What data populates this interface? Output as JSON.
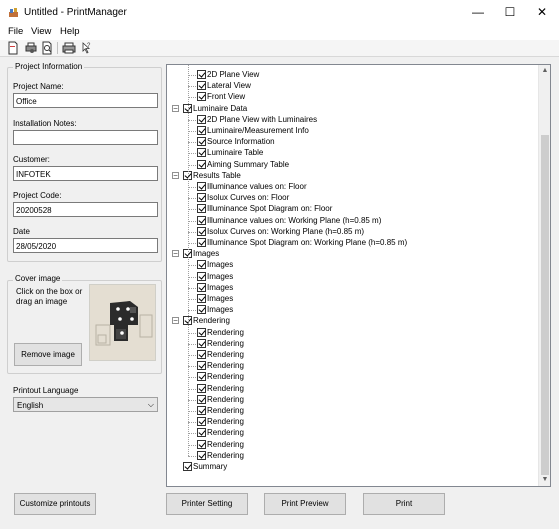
{
  "window": {
    "title": "Untitled - PrintManager",
    "minimize_glyph": "—",
    "maximize_glyph": "☐",
    "close_glyph": "✕"
  },
  "menu": [
    "File",
    "View",
    "Help"
  ],
  "toolbar": {
    "icons": [
      "new-document-icon",
      "print-setup-icon",
      "print-preview-icon",
      "print-icon",
      "help-pointer-icon"
    ]
  },
  "project_info": {
    "group_title": "Project Information",
    "project_name_label": "Project Name:",
    "project_name_value": "Office",
    "installation_notes_label": "Installation Notes:",
    "installation_notes_value": "",
    "customer_label": "Customer:",
    "customer_value": "INFOTEK",
    "project_code_label": "Project Code:",
    "project_code_value": "20200528",
    "date_label": "Date",
    "date_value": "28/05/2020"
  },
  "cover_image": {
    "group_title": "Cover image",
    "hint": "Click on the box or drag an image",
    "remove_label": "Remove image"
  },
  "printout_language": {
    "label": "Printout Language",
    "selected": "English"
  },
  "tree": {
    "rows": [
      {
        "label": "2D Plane View",
        "indent": 1,
        "checked": true
      },
      {
        "label": "Lateral View",
        "indent": 1,
        "checked": true
      },
      {
        "label": "Front View",
        "indent": 1,
        "checked": true
      },
      {
        "label": "Luminaire Data",
        "indent": 0,
        "checked": true,
        "expander": "−"
      },
      {
        "label": "2D Plane View with Luminaires",
        "indent": 1,
        "checked": true
      },
      {
        "label": "Luminaire/Measurement Info",
        "indent": 1,
        "checked": true
      },
      {
        "label": "Source Information",
        "indent": 1,
        "checked": true
      },
      {
        "label": "Luminaire Table",
        "indent": 1,
        "checked": true
      },
      {
        "label": "Aiming Summary Table",
        "indent": 1,
        "checked": true
      },
      {
        "label": "Results Table",
        "indent": 0,
        "checked": true,
        "expander": "−"
      },
      {
        "label": "Illuminance values on: Floor",
        "indent": 1,
        "checked": true
      },
      {
        "label": "Isolux Curves on: Floor",
        "indent": 1,
        "checked": true
      },
      {
        "label": "Illuminance Spot Diagram on: Floor",
        "indent": 1,
        "checked": true
      },
      {
        "label": "Illuminance values on: Working Plane (h=0.85 m)",
        "indent": 1,
        "checked": true
      },
      {
        "label": "Isolux Curves on: Working Plane (h=0.85 m)",
        "indent": 1,
        "checked": true
      },
      {
        "label": "Illuminance Spot Diagram on: Working Plane (h=0.85 m)",
        "indent": 1,
        "checked": true
      },
      {
        "label": "Images",
        "indent": 0,
        "checked": true,
        "expander": "−"
      },
      {
        "label": "Images",
        "indent": 1,
        "checked": true
      },
      {
        "label": "Images",
        "indent": 1,
        "checked": true
      },
      {
        "label": "Images",
        "indent": 1,
        "checked": true
      },
      {
        "label": "Images",
        "indent": 1,
        "checked": true
      },
      {
        "label": "Images",
        "indent": 1,
        "checked": true
      },
      {
        "label": "Rendering",
        "indent": 0,
        "checked": true,
        "expander": "−"
      },
      {
        "label": "Rendering",
        "indent": 1,
        "checked": true
      },
      {
        "label": "Rendering",
        "indent": 1,
        "checked": true
      },
      {
        "label": "Rendering",
        "indent": 1,
        "checked": true
      },
      {
        "label": "Rendering",
        "indent": 1,
        "checked": true
      },
      {
        "label": "Rendering",
        "indent": 1,
        "checked": true
      },
      {
        "label": "Rendering",
        "indent": 1,
        "checked": true
      },
      {
        "label": "Rendering",
        "indent": 1,
        "checked": true
      },
      {
        "label": "Rendering",
        "indent": 1,
        "checked": true
      },
      {
        "label": "Rendering",
        "indent": 1,
        "checked": true
      },
      {
        "label": "Rendering",
        "indent": 1,
        "checked": true
      },
      {
        "label": "Rendering",
        "indent": 1,
        "checked": true
      },
      {
        "label": "Rendering",
        "indent": 1,
        "checked": true
      },
      {
        "label": "Summary",
        "indent": 0,
        "checked": true
      }
    ]
  },
  "buttons": {
    "customize": "Customize printouts",
    "printer_setting": "Printer Setting",
    "print_preview": "Print Preview",
    "print": "Print"
  }
}
